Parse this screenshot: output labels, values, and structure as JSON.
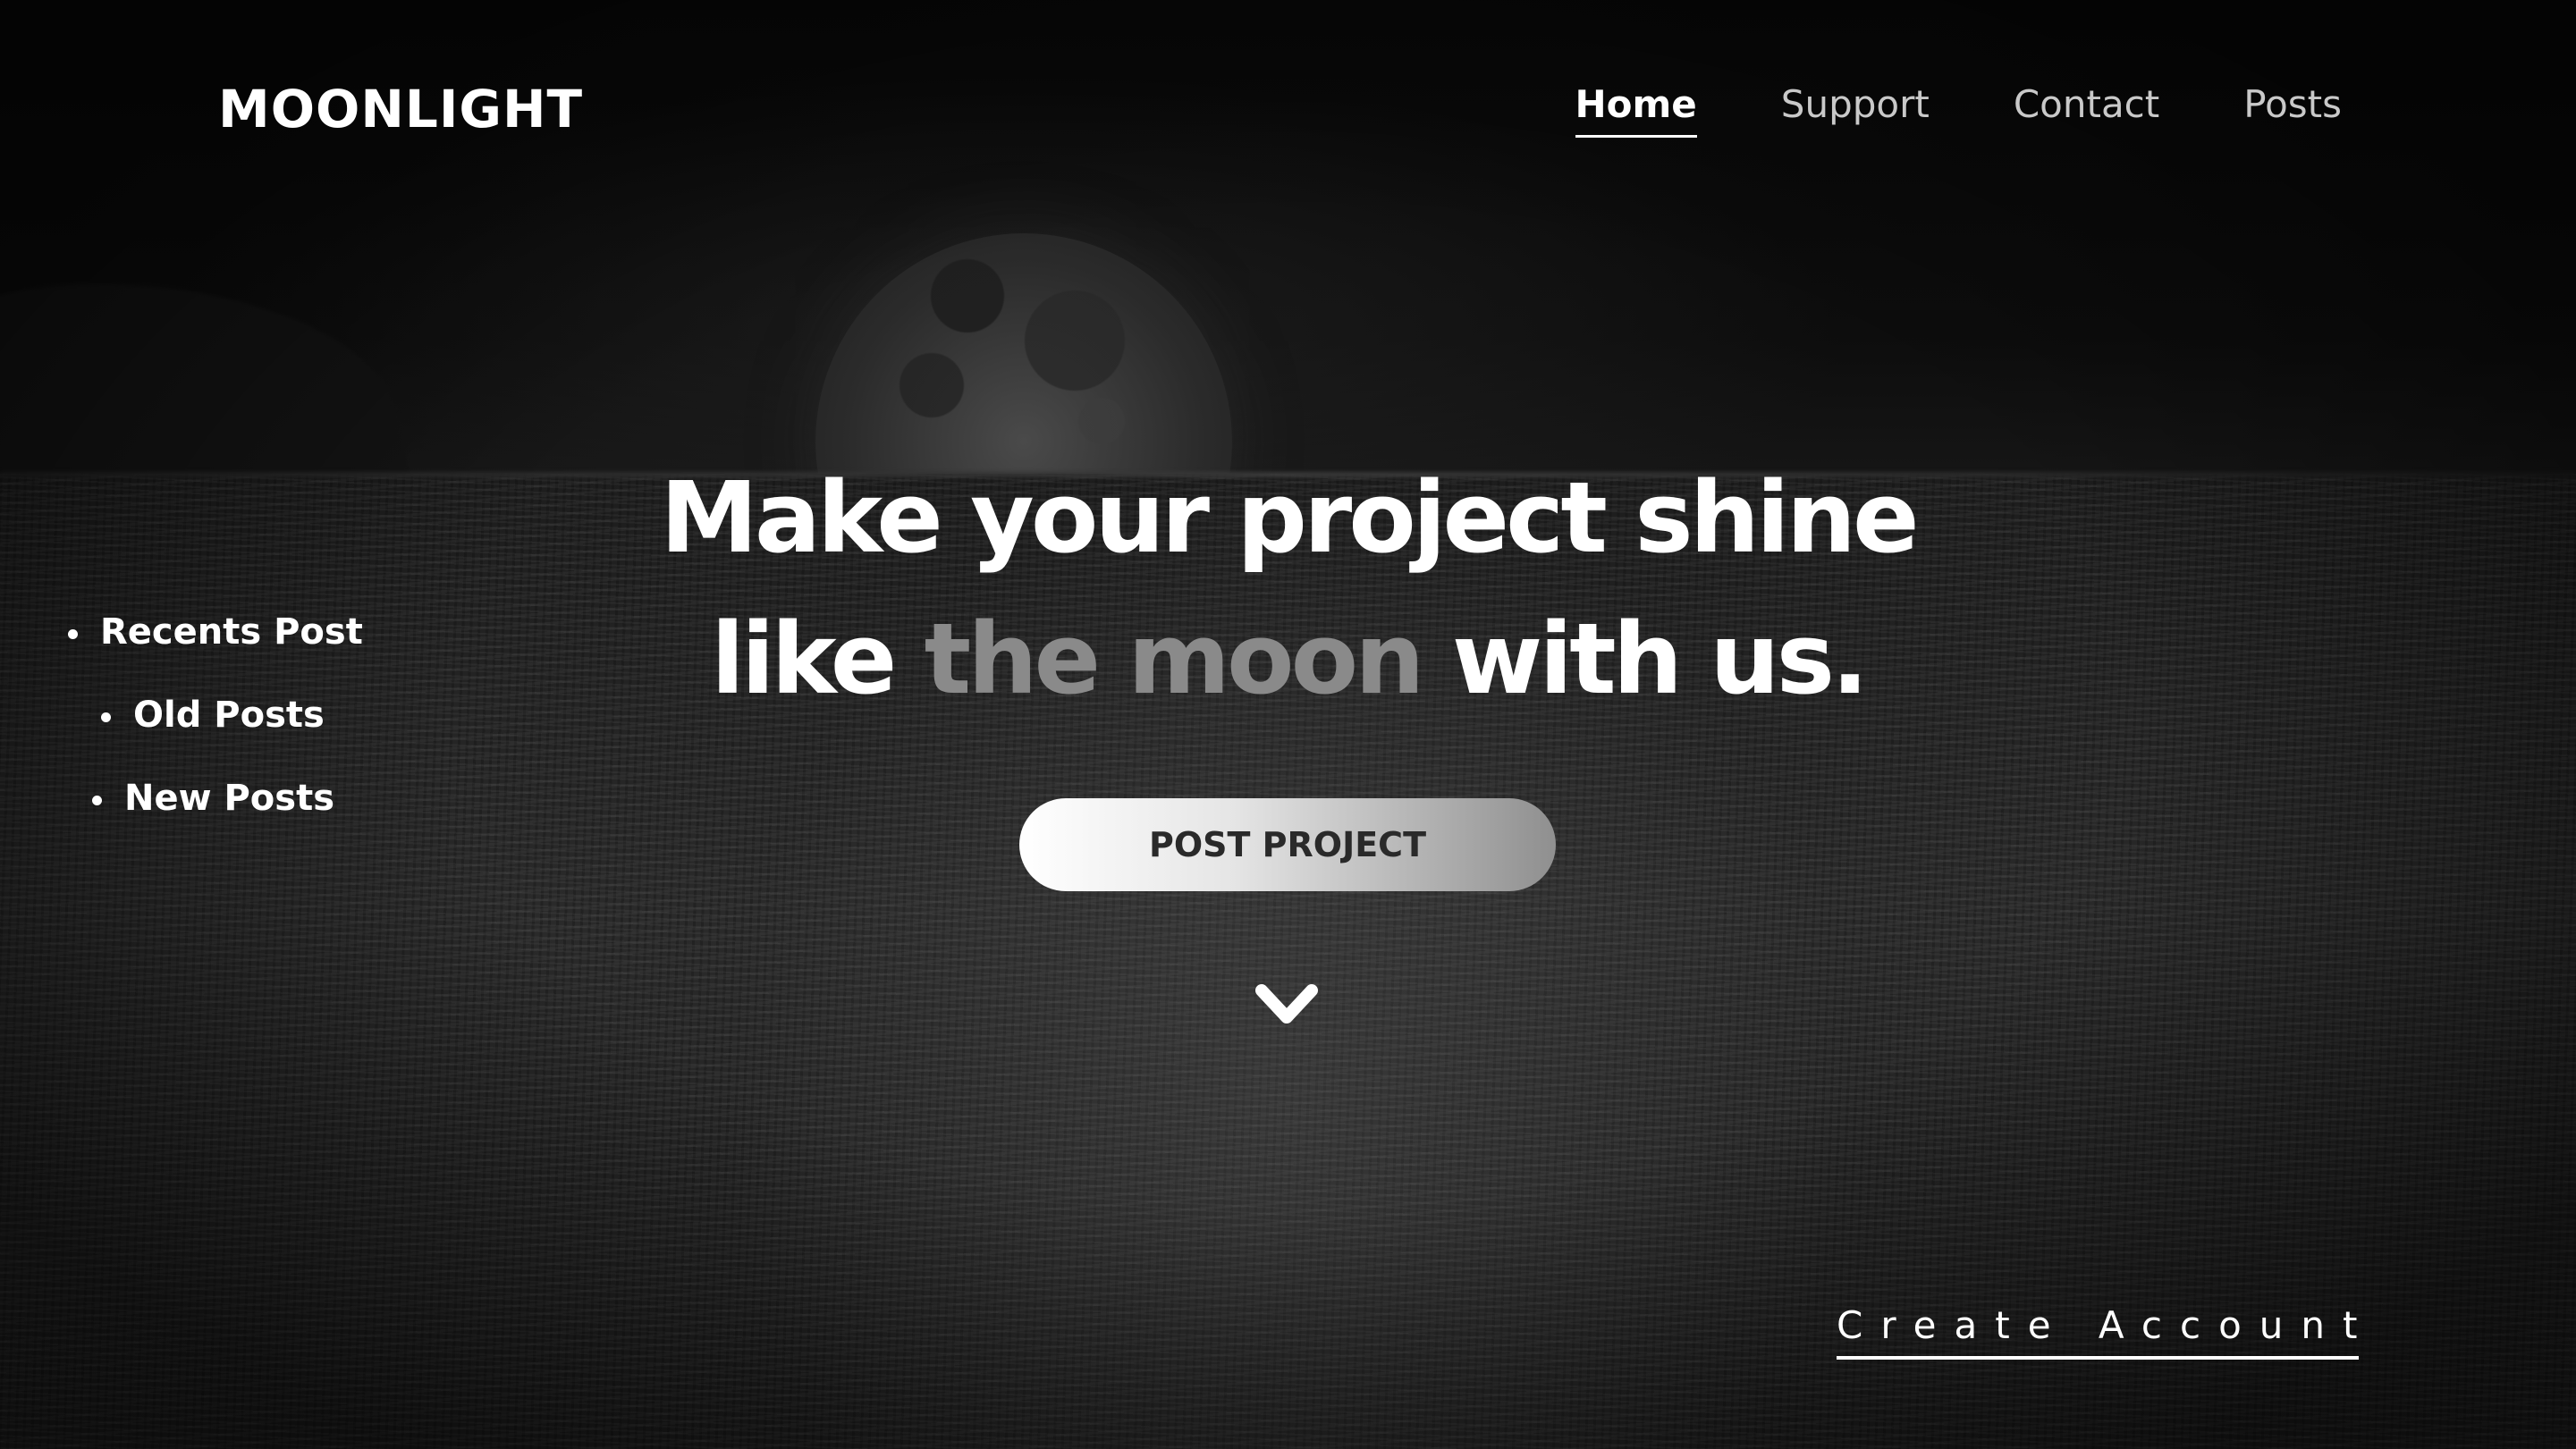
{
  "header": {
    "logo": "MOONLIGHT",
    "nav": [
      {
        "label": "Home",
        "active": true
      },
      {
        "label": "Support",
        "active": false
      },
      {
        "label": "Contact",
        "active": false
      },
      {
        "label": "Posts",
        "active": false
      }
    ]
  },
  "sidebar": {
    "items": [
      {
        "label": "Recents Post"
      },
      {
        "label": "Old Posts"
      },
      {
        "label": "New Posts"
      }
    ]
  },
  "hero": {
    "line1": "Make your project shine",
    "line2_start": "like ",
    "line2_highlight": "the moon",
    "line2_end": " with us.",
    "cta_label": "POST PROJECT",
    "scroll_icon": "chevron-down-icon"
  },
  "footer": {
    "create_account": "Create Account"
  },
  "colors": {
    "background": "#090909",
    "text": "#ffffff",
    "highlight_text": "#8a8a8a",
    "button_text": "#2a2a2a"
  }
}
